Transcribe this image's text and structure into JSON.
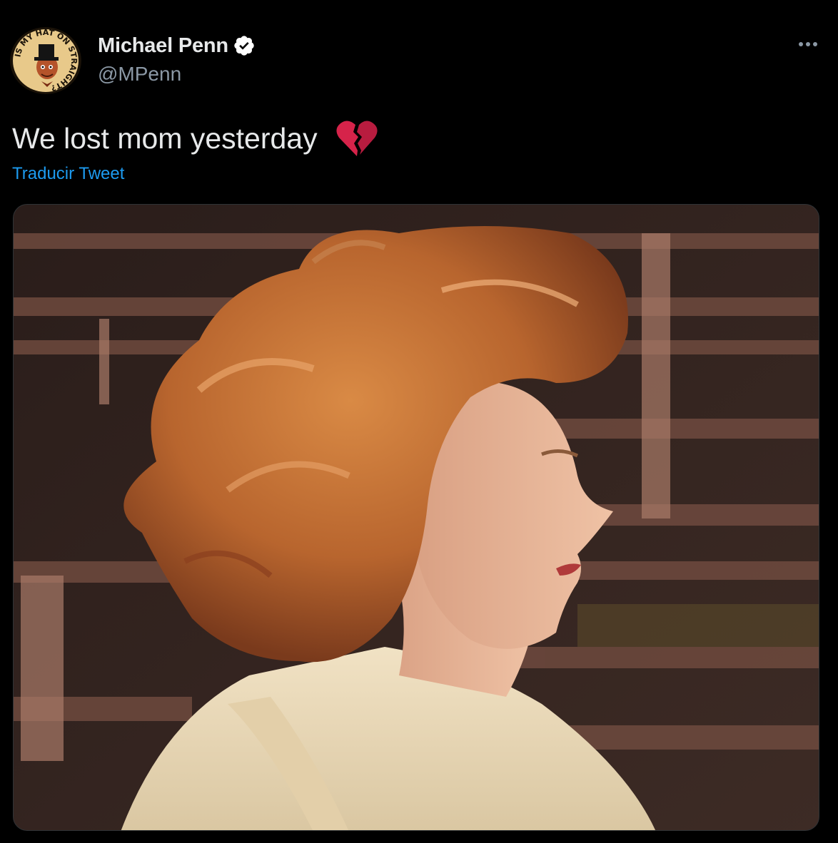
{
  "tweet": {
    "display_name": "Michael Penn",
    "handle": "@MPenn",
    "verified": true,
    "text": "We lost mom yesterday",
    "emoji": "broken-heart-icon",
    "translate_label": "Traducir Tweet"
  },
  "avatar": {
    "ring_text": "IS MY HAT ON STRAIGHT?"
  },
  "menu": {
    "icon": "more-horizontal-icon"
  },
  "colors": {
    "background": "#000000",
    "text": "#e7e9ea",
    "secondary": "#8b98a5",
    "link": "#1d9bf0",
    "verified_badge": "#ffffff"
  }
}
